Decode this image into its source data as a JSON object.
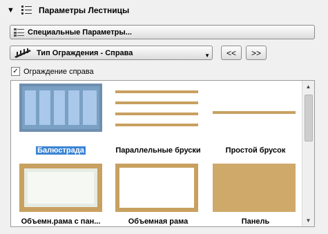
{
  "panel": {
    "title": "Параметры Лестницы"
  },
  "buttons": {
    "special_params": "Специальные Параметры...",
    "prev": "<<",
    "next": ">>"
  },
  "railing_type": {
    "selected": "Тип Ограждения - Справа"
  },
  "checkbox": {
    "label": "Ограждение справа",
    "checked": true
  },
  "gallery": {
    "items": [
      {
        "label": "Балюстрада",
        "selected": true
      },
      {
        "label": "Параллельные бруски",
        "selected": false
      },
      {
        "label": "Простой брусок",
        "selected": false
      },
      {
        "label": "Объемн.рама с пан...",
        "selected": false
      },
      {
        "label": "Объемная рама",
        "selected": false
      },
      {
        "label": "Панель",
        "selected": false
      }
    ]
  },
  "colors": {
    "selection": "#3b84d4",
    "wood": "#c8a060",
    "glass": "#9cc0e6"
  }
}
